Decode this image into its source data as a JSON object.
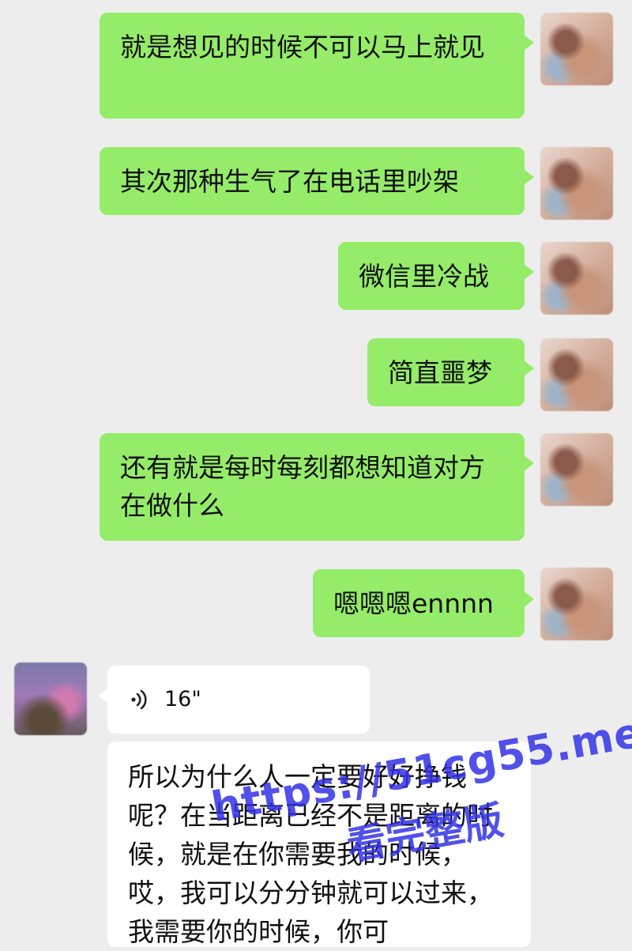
{
  "messages": [
    {
      "dir": "out",
      "text": "就是想见的时候不可以马上就见"
    },
    {
      "dir": "out",
      "text": "其次那种生气了在电话里吵架"
    },
    {
      "dir": "out",
      "text": "微信里冷战"
    },
    {
      "dir": "out",
      "text": "简直噩梦"
    },
    {
      "dir": "out",
      "text": "还有就是每时每刻都想知道对方在做什么"
    },
    {
      "dir": "out",
      "text": "嗯嗯嗯ennnn"
    },
    {
      "dir": "in",
      "type": "voice",
      "duration": "16\""
    },
    {
      "dir": "in",
      "text": "所以为什么人一定要好好挣钱呢？在当距离已经不是距离的时候，就是在你需要我的时候，哎，我可以分分钟就可以过来，我需要你的时候，你可"
    }
  ],
  "watermark": {
    "url": "https://51cg55.me",
    "subtitle": "看完整版"
  },
  "colors": {
    "bg": "#ededed",
    "sent_bubble": "#95ec69",
    "received_bubble": "#ffffff",
    "watermark": "#3232e6"
  },
  "icons": {
    "voice": "sound-wave-icon",
    "avatar_self": "avatar-image",
    "avatar_other": "avatar-image"
  }
}
